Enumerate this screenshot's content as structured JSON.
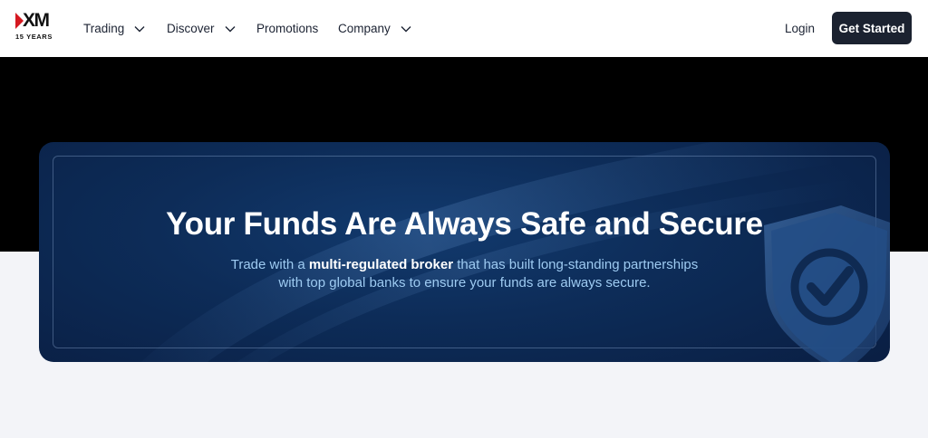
{
  "brand": {
    "logo_text": "XM",
    "logo_subtext": "15 YEARS",
    "accent": "#d51820"
  },
  "nav": {
    "items": [
      {
        "label": "Trading",
        "has_dropdown": true
      },
      {
        "label": "Discover",
        "has_dropdown": true
      },
      {
        "label": "Promotions",
        "has_dropdown": false
      },
      {
        "label": "Company",
        "has_dropdown": true
      }
    ],
    "login_label": "Login",
    "cta_label": "Get Started",
    "cta_color": "#1b2230"
  },
  "hero": {
    "title": "Your Funds Are Always Safe and Secure",
    "subtitle_before": "Trade with a ",
    "subtitle_highlight": "multi-regulated broker",
    "subtitle_after_line1": " that has built long-standing partnerships",
    "subtitle_line2": "with top global banks to ensure your funds are always secure.",
    "icons": [
      "shield-check-icon"
    ],
    "card_color": "#0d2c58",
    "text_color": "#9ecbf2"
  }
}
